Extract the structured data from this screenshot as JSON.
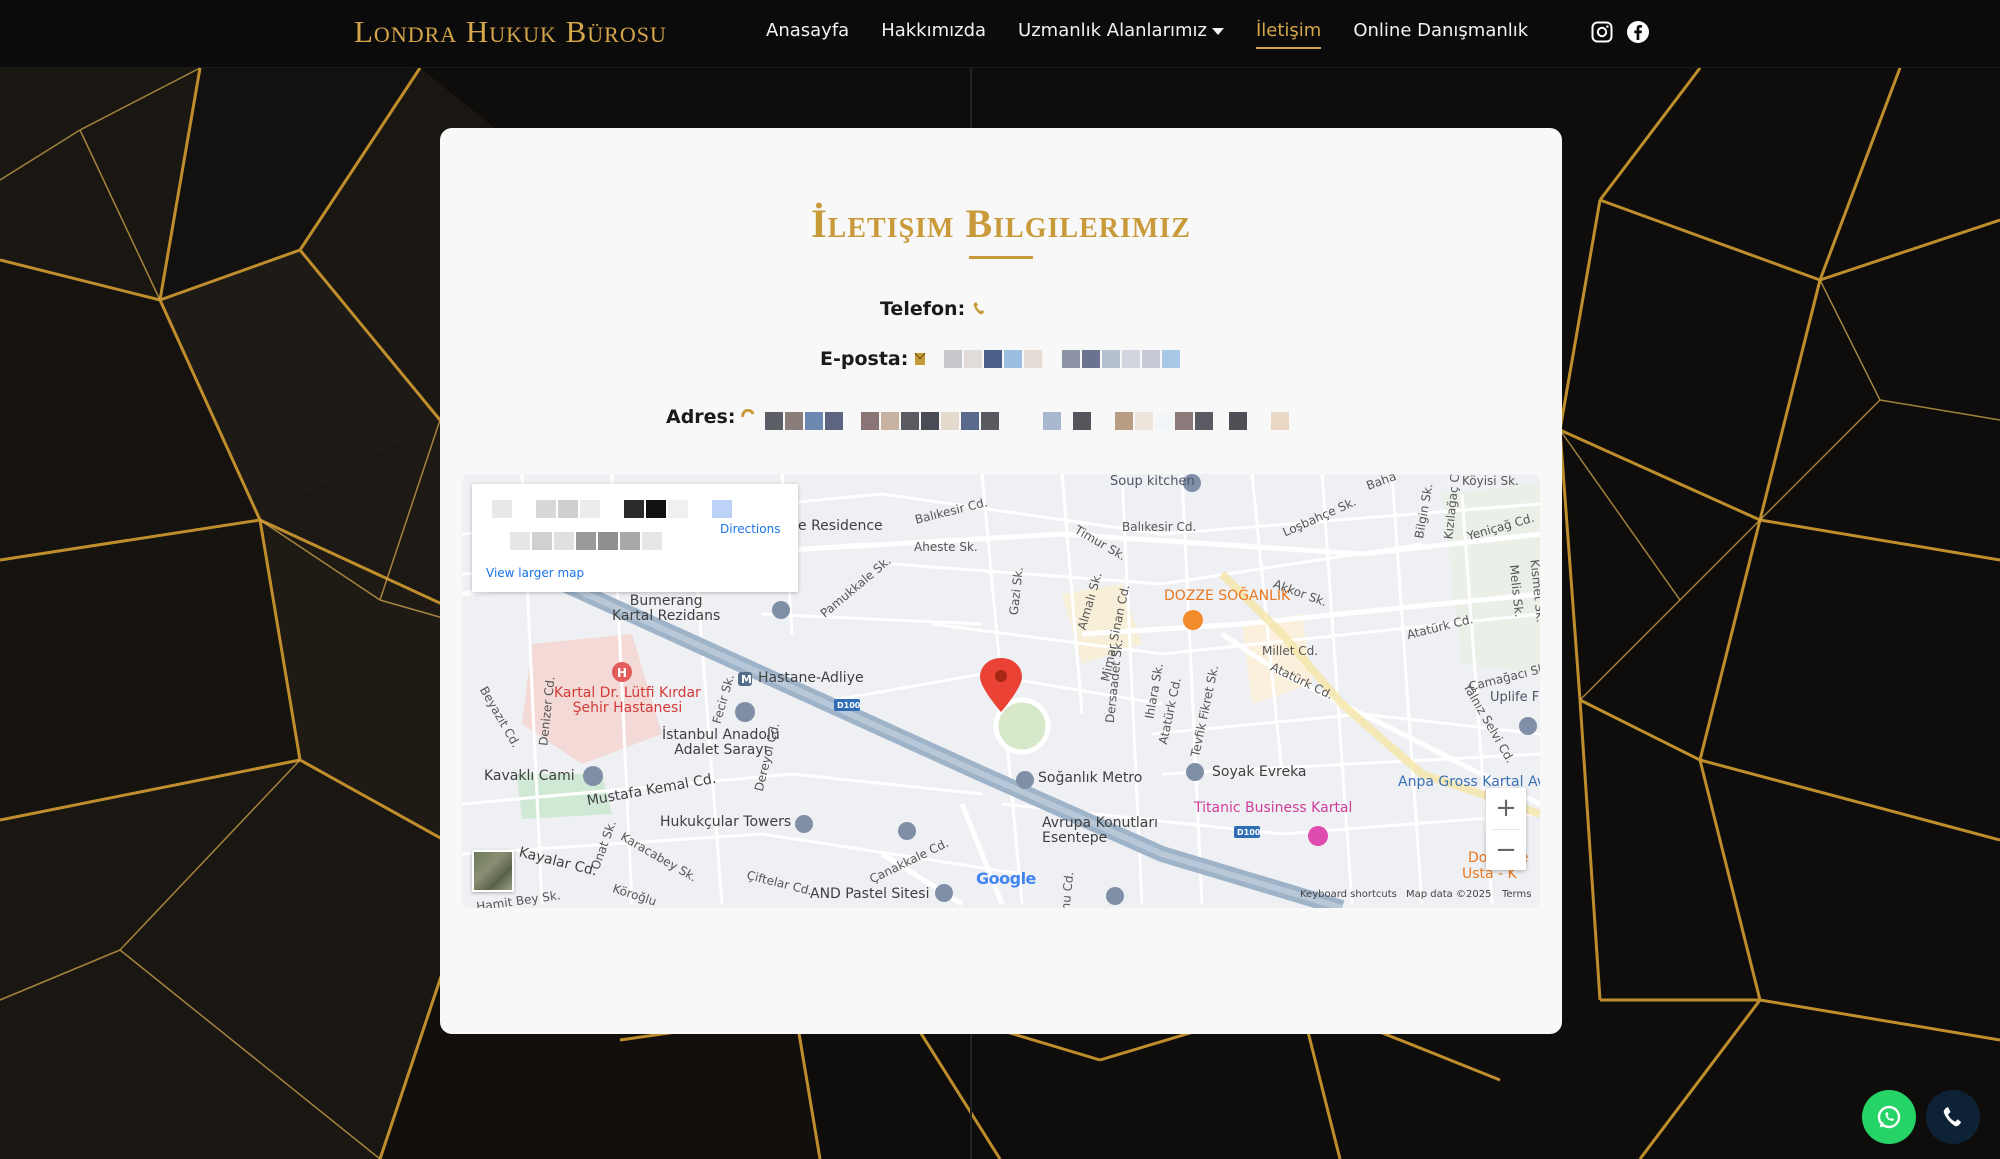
{
  "brand": "Londra Hukuk Bürosu",
  "nav": {
    "items": [
      {
        "label": "Anasayfa"
      },
      {
        "label": "Hakkımızda"
      },
      {
        "label": "Uzmanlık Alanlarımız"
      },
      {
        "label": "İletişim"
      },
      {
        "label": "Online Danışmanlık"
      }
    ],
    "active_index": 3,
    "social": [
      "instagram-icon",
      "facebook-icon"
    ]
  },
  "colors": {
    "gold": "#d6a64a",
    "card": "#f8f8f8",
    "whatsapp": "#25d366",
    "call": "#0e2236"
  },
  "contact": {
    "title": "İletişim Bilgilerimiz",
    "phone_label": "Telefon:",
    "email_label": "E-posta:",
    "address_label": "Adres:",
    "phone_icon": "phone-icon",
    "email_icon": "envelope-icon",
    "address_icon": "pin-icon"
  },
  "map": {
    "popup": {
      "directions": "Directions",
      "view_larger": "View larger map"
    },
    "labels": {
      "soup": "Soup kitchen",
      "residence": "e Residence",
      "balikesir1": "Balıkesir Cd.",
      "balikesir2": "Balıkesir Cd.",
      "aheste": "Aheste Sk.",
      "timur": "Timur Sk.",
      "losbahce": "Loşbahçe Sk.",
      "bilgin": "Bilgin Sk.",
      "yenicag": "Yeniçağ Cd.",
      "bumerang": "Bumerang\nKartal Rezidans",
      "pamukkale": "Pamukkale Sk.",
      "gazi": "Gazi Sk.",
      "almali": "Almalı Sk.",
      "mimar": "Mimar Sinan Cd.",
      "dozze": "DOZZE SOĞANLIK",
      "akkor": "Akkor Sk.",
      "ataturk1": "Atatürk Cd.",
      "millet": "Millet Cd.",
      "ataturk2": "Atatürk Cd.",
      "camagaci": "Çamağacı Sk.",
      "uplife": "Uplife F",
      "yalniz": "Yalnız Selvi Cd.",
      "hastane_adliye": "Hastane-Adliye",
      "d100a": "D100",
      "kartal_hosp": "Kartal Dr. Lütfi Kırdar\nŞehir Hastanesi",
      "beyazit": "Beyazıt Cd.",
      "denizer": "Denizer Cd.",
      "fecir": "Fecir Sk.",
      "adalet": "İstanbul Anadolu\nAdalet Sarayı",
      "dersaadet": "Dersaadet Sk.",
      "ihlara": "Ihlara Sk.",
      "ataturk3": "Atatürk Cd.",
      "tevfik": "Tevfik Fikret Sk.",
      "kavakli": "Kavaklı Cami",
      "mustafa": "Mustafa Kemal Cd.",
      "dereyol": "Dereyol Cd.",
      "soganlik": "Soğanlık Metro",
      "soyak": "Soyak Evreka",
      "anpa": "Anpa Gross Kartal Av",
      "titanic": "Titanic Business Kartal",
      "hukukcular": "Hukukçular Towers",
      "avrupa": "Avrupa Konutları\nEsentepe",
      "canakkale": "Çanakkale Cd.",
      "d100b": "D100",
      "ciftelar": "Çiftelar Cd.",
      "and": "AND Pastel Sitesi",
      "kayalar": "Kayalar Cd.",
      "karacabey": "Karacabey Sk.",
      "koroglu": "Köroğlu",
      "onat": "Onat Sk.",
      "hamitbey": "Hamit Bey Sk.",
      "do": "Do",
      "usta": "Usta - K",
      "ku": "Ku",
      "ce": "ce",
      "koyisi": "Köyisi Sk.",
      "kizilagac": "Kızılağaç Cd.",
      "melis": "Melis Sk.",
      "kismet": "Kısmet Sk.",
      "baha": "Baha",
      "ku2": "nu Cd."
    },
    "google": "Google",
    "keyboard": "Keyboard shortcuts",
    "mapdata": "Map data ©2025",
    "terms": "Terms",
    "zoom_in": "+",
    "zoom_out": "−"
  },
  "fabs": [
    "whatsapp-icon",
    "phone-call-icon"
  ]
}
